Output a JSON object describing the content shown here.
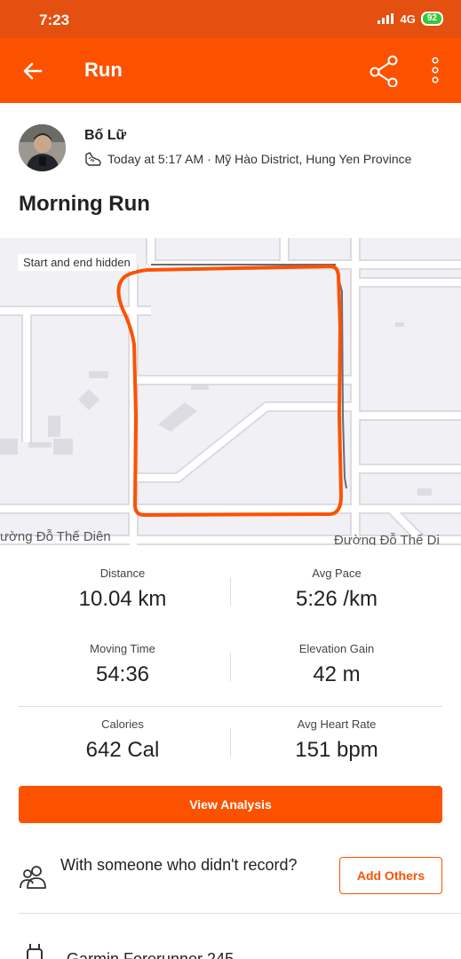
{
  "status_bar": {
    "time": "7:23",
    "network": "4G",
    "battery": "92"
  },
  "app_bar": {
    "title": "Run",
    "back_icon": "arrow-left-icon",
    "share_icon": "share-icon",
    "more_icon": "more-vertical-icon"
  },
  "athlete": {
    "name": "Bố Lữ",
    "activity_icon": "shoe-icon",
    "meta": "Today at 5:17 AM · Mỹ Hào District, Hung Yen Province"
  },
  "activity": {
    "title": "Morning Run"
  },
  "map": {
    "privacy_label": "Start and end hidden",
    "street_left": "ường Đỗ Thế Diên",
    "street_right": "Đường Đỗ Thế Di",
    "route_color": "#fc5200"
  },
  "stats": [
    {
      "label": "Distance",
      "value": "10.04 km"
    },
    {
      "label": "Avg Pace",
      "value": "5:26 /km"
    },
    {
      "label": "Moving Time",
      "value": "54:36"
    },
    {
      "label": "Elevation Gain",
      "value": "42 m"
    },
    {
      "label": "Calories",
      "value": "642 Cal"
    },
    {
      "label": "Avg Heart Rate",
      "value": "151 bpm"
    }
  ],
  "actions": {
    "view_analysis": "View Analysis",
    "with_others_text": "With someone who didn't record?",
    "add_others": "Add Others"
  },
  "gear": {
    "label": "Garmin Forerunner 245",
    "icon": "watch-icon"
  },
  "colors": {
    "brand": "#fc5200",
    "status_bar": "#e4500f"
  }
}
